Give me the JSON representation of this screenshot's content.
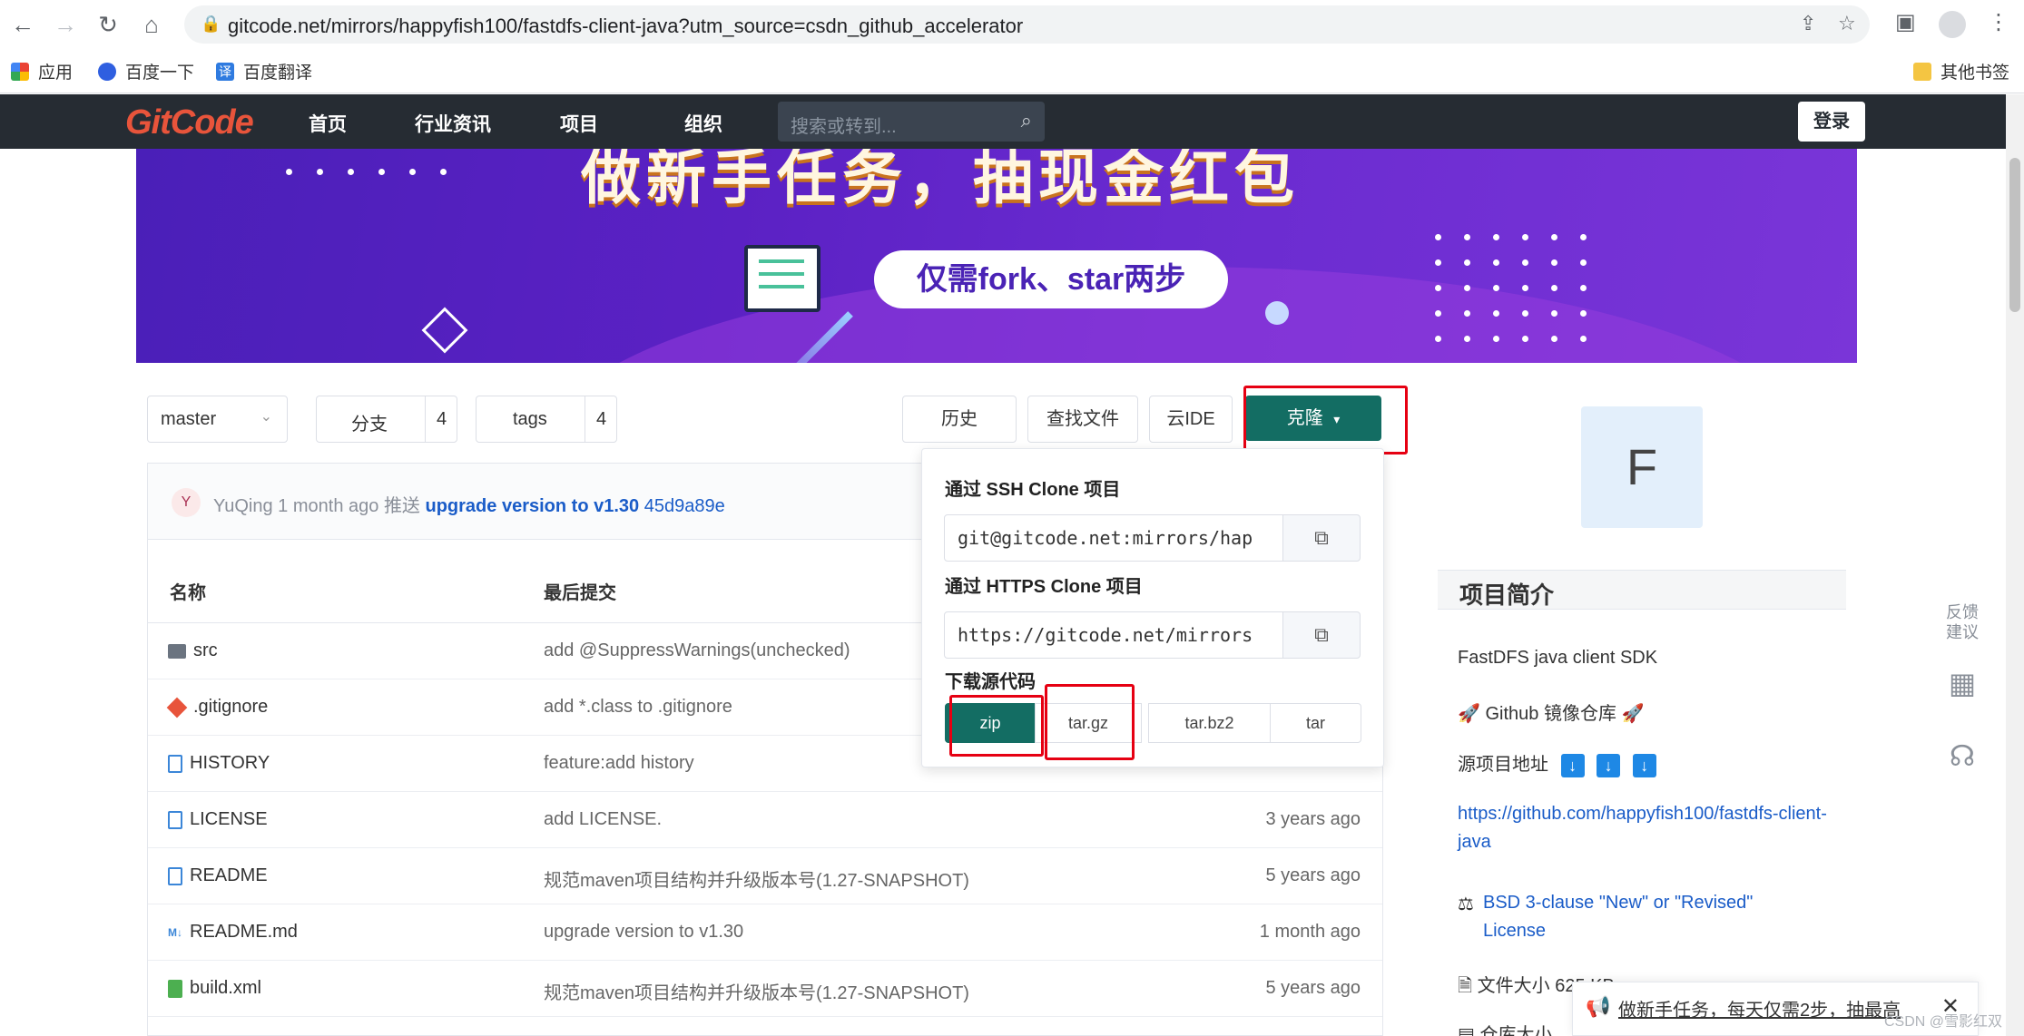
{
  "browser": {
    "url": "gitcode.net/mirrors/happyfish100/fastdfs-client-java?utm_source=csdn_github_accelerator",
    "bookmarks": [
      "应用",
      "百度一下",
      "百度翻译"
    ],
    "other_bookmarks": "其他书签"
  },
  "header": {
    "logo": "GitCode",
    "nav": [
      "首页",
      "行业资讯",
      "项目",
      "组织"
    ],
    "search_placeholder": "搜索或转到...",
    "login": "登录"
  },
  "banner": {
    "title": "做新手任务，抽现金红包",
    "pill": "仅需fork、star两步"
  },
  "branch_bar": {
    "branch": "master",
    "branches_label": "分支",
    "branches_count": "4",
    "tags_label": "tags",
    "tags_count": "4",
    "history": "历史",
    "find_file": "查找文件",
    "web_ide": "云IDE",
    "clone": "克隆"
  },
  "last_commit": {
    "avatar": "Y",
    "author": "YuQing",
    "time": "1 month ago",
    "action": "推送",
    "message": "upgrade version to v1.30",
    "hash": "45d9a89e"
  },
  "table": {
    "col_name": "名称",
    "col_commit": "最后提交",
    "rows": [
      {
        "name": "src",
        "message": "add @SuppressWarnings(unchecked)",
        "time": "",
        "icon": "folder-icon"
      },
      {
        "name": ".gitignore",
        "message": "add *.class to .gitignore",
        "time": "",
        "icon": "git-icon"
      },
      {
        "name": "HISTORY",
        "message": "feature:add history",
        "time": "",
        "icon": "file-icon"
      },
      {
        "name": "LICENSE",
        "message": "add LICENSE.",
        "time": "3 years ago",
        "icon": "file-icon"
      },
      {
        "name": "README",
        "message": "规范maven项目结构并升级版本号(1.27-SNAPSHOT)",
        "time": "5 years ago",
        "icon": "file-icon"
      },
      {
        "name": "README.md",
        "message": "upgrade version to v1.30",
        "time": "1 month ago",
        "icon": "markdown-icon"
      },
      {
        "name": "build.xml",
        "message": "规范maven项目结构并升级版本号(1.27-SNAPSHOT)",
        "time": "5 years ago",
        "icon": "xml-icon"
      }
    ]
  },
  "clone_dropdown": {
    "ssh_label": "通过 SSH Clone 项目",
    "ssh_url": "git@gitcode.net:mirrors/hap",
    "https_label": "通过 HTTPS Clone 项目",
    "https_url": "https://gitcode.net/mirrors",
    "download_label": "下载源代码",
    "formats": [
      "zip",
      "tar.gz",
      "tar.bz2",
      "tar"
    ]
  },
  "sidebar": {
    "avatar_letter": "F",
    "intro_title": "项目简介",
    "description": "FastDFS java client SDK",
    "mirror_label": "Github 镜像仓库",
    "source_label": "源项目地址",
    "source_url": "https://github.com/happyfish100/fastdfs-client-java",
    "license": "BSD 3-clause \"New\" or \"Revised\" License",
    "file_size": "文件大小 625 KB",
    "repo_size": "仓库大小"
  },
  "float_tools": {
    "feedback": "反馈建议"
  },
  "notification": {
    "text": "做新手任务，每天仅需2步，抽最高"
  },
  "watermark": "CSDN @雪影红双"
}
